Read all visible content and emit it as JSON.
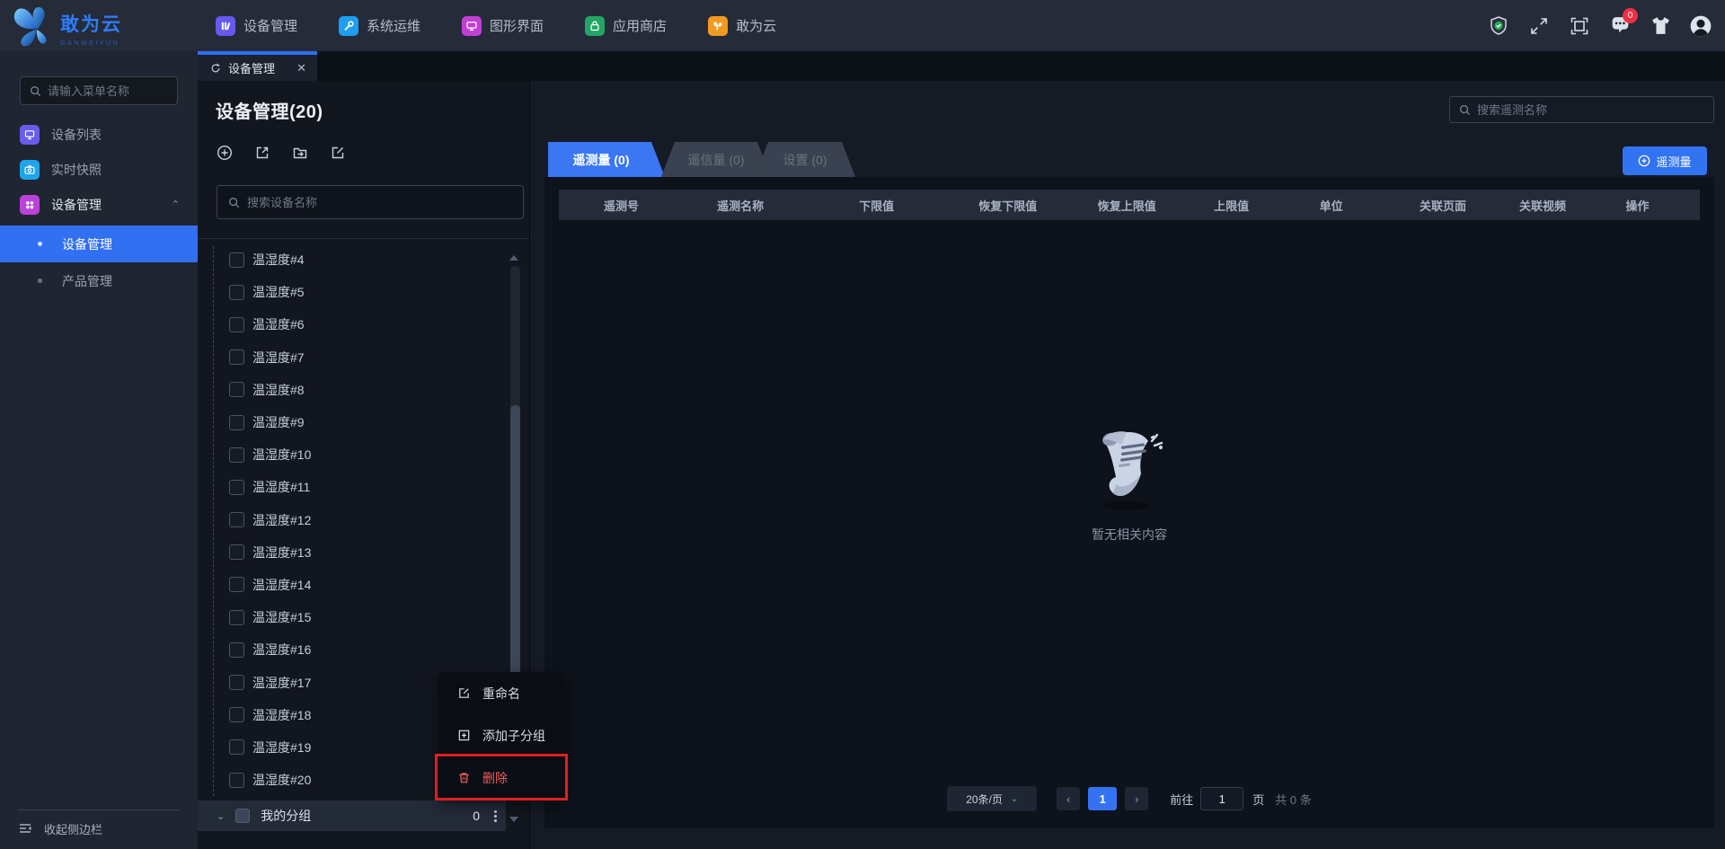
{
  "navbar": {
    "brand": {
      "title": "敢为云",
      "subtitle": "GANWEIYUN"
    },
    "items": [
      {
        "label": "设备管理",
        "active": true
      },
      {
        "label": "系统运维",
        "active": false
      },
      {
        "label": "图形界面",
        "active": false
      },
      {
        "label": "应用商店",
        "active": false
      },
      {
        "label": "敢为云",
        "active": false
      }
    ],
    "message_badge": "0"
  },
  "sidebar": {
    "search_placeholder": "请输入菜单名称",
    "items": [
      {
        "label": "设备列表"
      },
      {
        "label": "实时快照"
      },
      {
        "label": "设备管理",
        "expanded": true
      }
    ],
    "sub_items": [
      {
        "label": "设备管理",
        "active": true
      },
      {
        "label": "产品管理",
        "active": false
      }
    ],
    "collapse_label": "收起侧边栏"
  },
  "doc_tab": {
    "label": "设备管理"
  },
  "device_panel": {
    "title": "设备管理(20)",
    "search_placeholder": "搜索设备名称",
    "devices": [
      "温湿度#4",
      "温湿度#5",
      "温湿度#6",
      "温湿度#7",
      "温湿度#8",
      "温湿度#9",
      "温湿度#10",
      "温湿度#11",
      "温湿度#12",
      "温湿度#13",
      "温湿度#14",
      "温湿度#15",
      "温湿度#16",
      "温湿度#17",
      "温湿度#18",
      "温湿度#19",
      "温湿度#20"
    ],
    "group": {
      "label": "我的分组",
      "count": "0"
    }
  },
  "context_menu": {
    "items": [
      {
        "label": "重命名"
      },
      {
        "label": "添加子分组"
      },
      {
        "label": "删除",
        "danger": true,
        "highlighted": true
      }
    ]
  },
  "telemetry_panel": {
    "search_placeholder": "搜索遥测名称",
    "tabs": [
      {
        "label": "遥测量 (0)",
        "active": true
      },
      {
        "label": "遥信量 (0)",
        "active": false
      },
      {
        "label": "设置 (0)",
        "active": false
      }
    ],
    "add_button_label": "遥测量",
    "table_headers": [
      "遥测号",
      "遥测名称",
      "下限值",
      "恢复下限值",
      "恢复上限值",
      "上限值",
      "单位",
      "关联页面",
      "关联视频",
      "操作"
    ],
    "empty_text": "暂无相关内容",
    "pagination": {
      "page_size": "20条/页",
      "prev": "‹",
      "current_page": "1",
      "next": "›",
      "goto_label": "前往",
      "goto_value": "1",
      "page_label": "页",
      "total_label": "共 0 条"
    }
  },
  "colors": {
    "accent_blue": "#3273f1",
    "danger_red": "#e01f1f",
    "badge_red": "#ef2f44",
    "nav_icon_purple": "#6659f0",
    "nav_icon_blue": "#1e9df2",
    "nav_icon_magenta": "#c23fd4",
    "nav_icon_green": "#23a566",
    "nav_icon_orange": "#f29a1f"
  }
}
